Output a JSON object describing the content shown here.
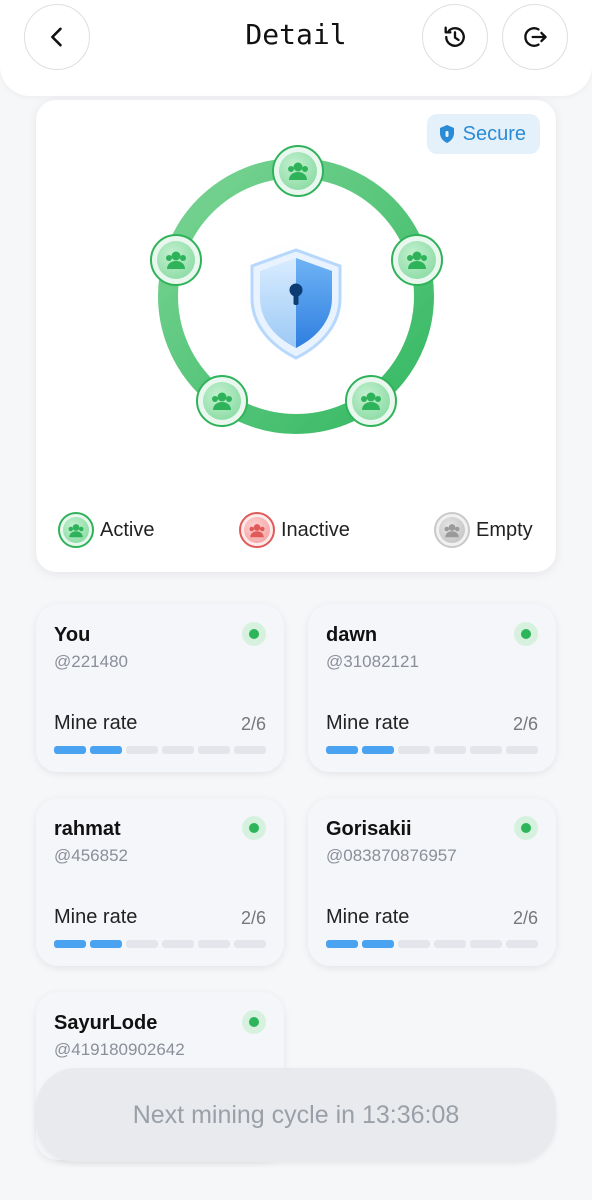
{
  "header": {
    "title": "Detail"
  },
  "badge": {
    "label": "Secure"
  },
  "legend": [
    {
      "label": "Active",
      "status": "active"
    },
    {
      "label": "Inactive",
      "status": "inactive"
    },
    {
      "label": "Empty",
      "status": "empty"
    }
  ],
  "colors": {
    "accent_green": "#2fb35a",
    "bar_blue": "#4aa3f0",
    "secure_blue": "#2a8bd6",
    "inactive_red": "#e15a5a"
  },
  "members": [
    {
      "name": "You",
      "handle": "@221480",
      "rate_label": "Mine rate",
      "rate_text": "2/6",
      "rate_filled": 2,
      "rate_total": 6,
      "status": "active"
    },
    {
      "name": "dawn",
      "handle": "@31082121",
      "rate_label": "Mine rate",
      "rate_text": "2/6",
      "rate_filled": 2,
      "rate_total": 6,
      "status": "active"
    },
    {
      "name": "rahmat",
      "handle": "@456852",
      "rate_label": "Mine rate",
      "rate_text": "2/6",
      "rate_filled": 2,
      "rate_total": 6,
      "status": "active"
    },
    {
      "name": "Gorisakii",
      "handle": "@083870876957",
      "rate_label": "Mine rate",
      "rate_text": "2/6",
      "rate_filled": 2,
      "rate_total": 6,
      "status": "active"
    },
    {
      "name": "SayurLode",
      "handle": "@419180902642",
      "status": "active"
    }
  ],
  "cycle": {
    "text": "Next mining cycle in 13:36:08"
  },
  "icons": [
    "back-arrow-icon",
    "history-icon",
    "logout-icon",
    "shield-lock-icon",
    "group-icon",
    "status-dot-icon"
  ]
}
